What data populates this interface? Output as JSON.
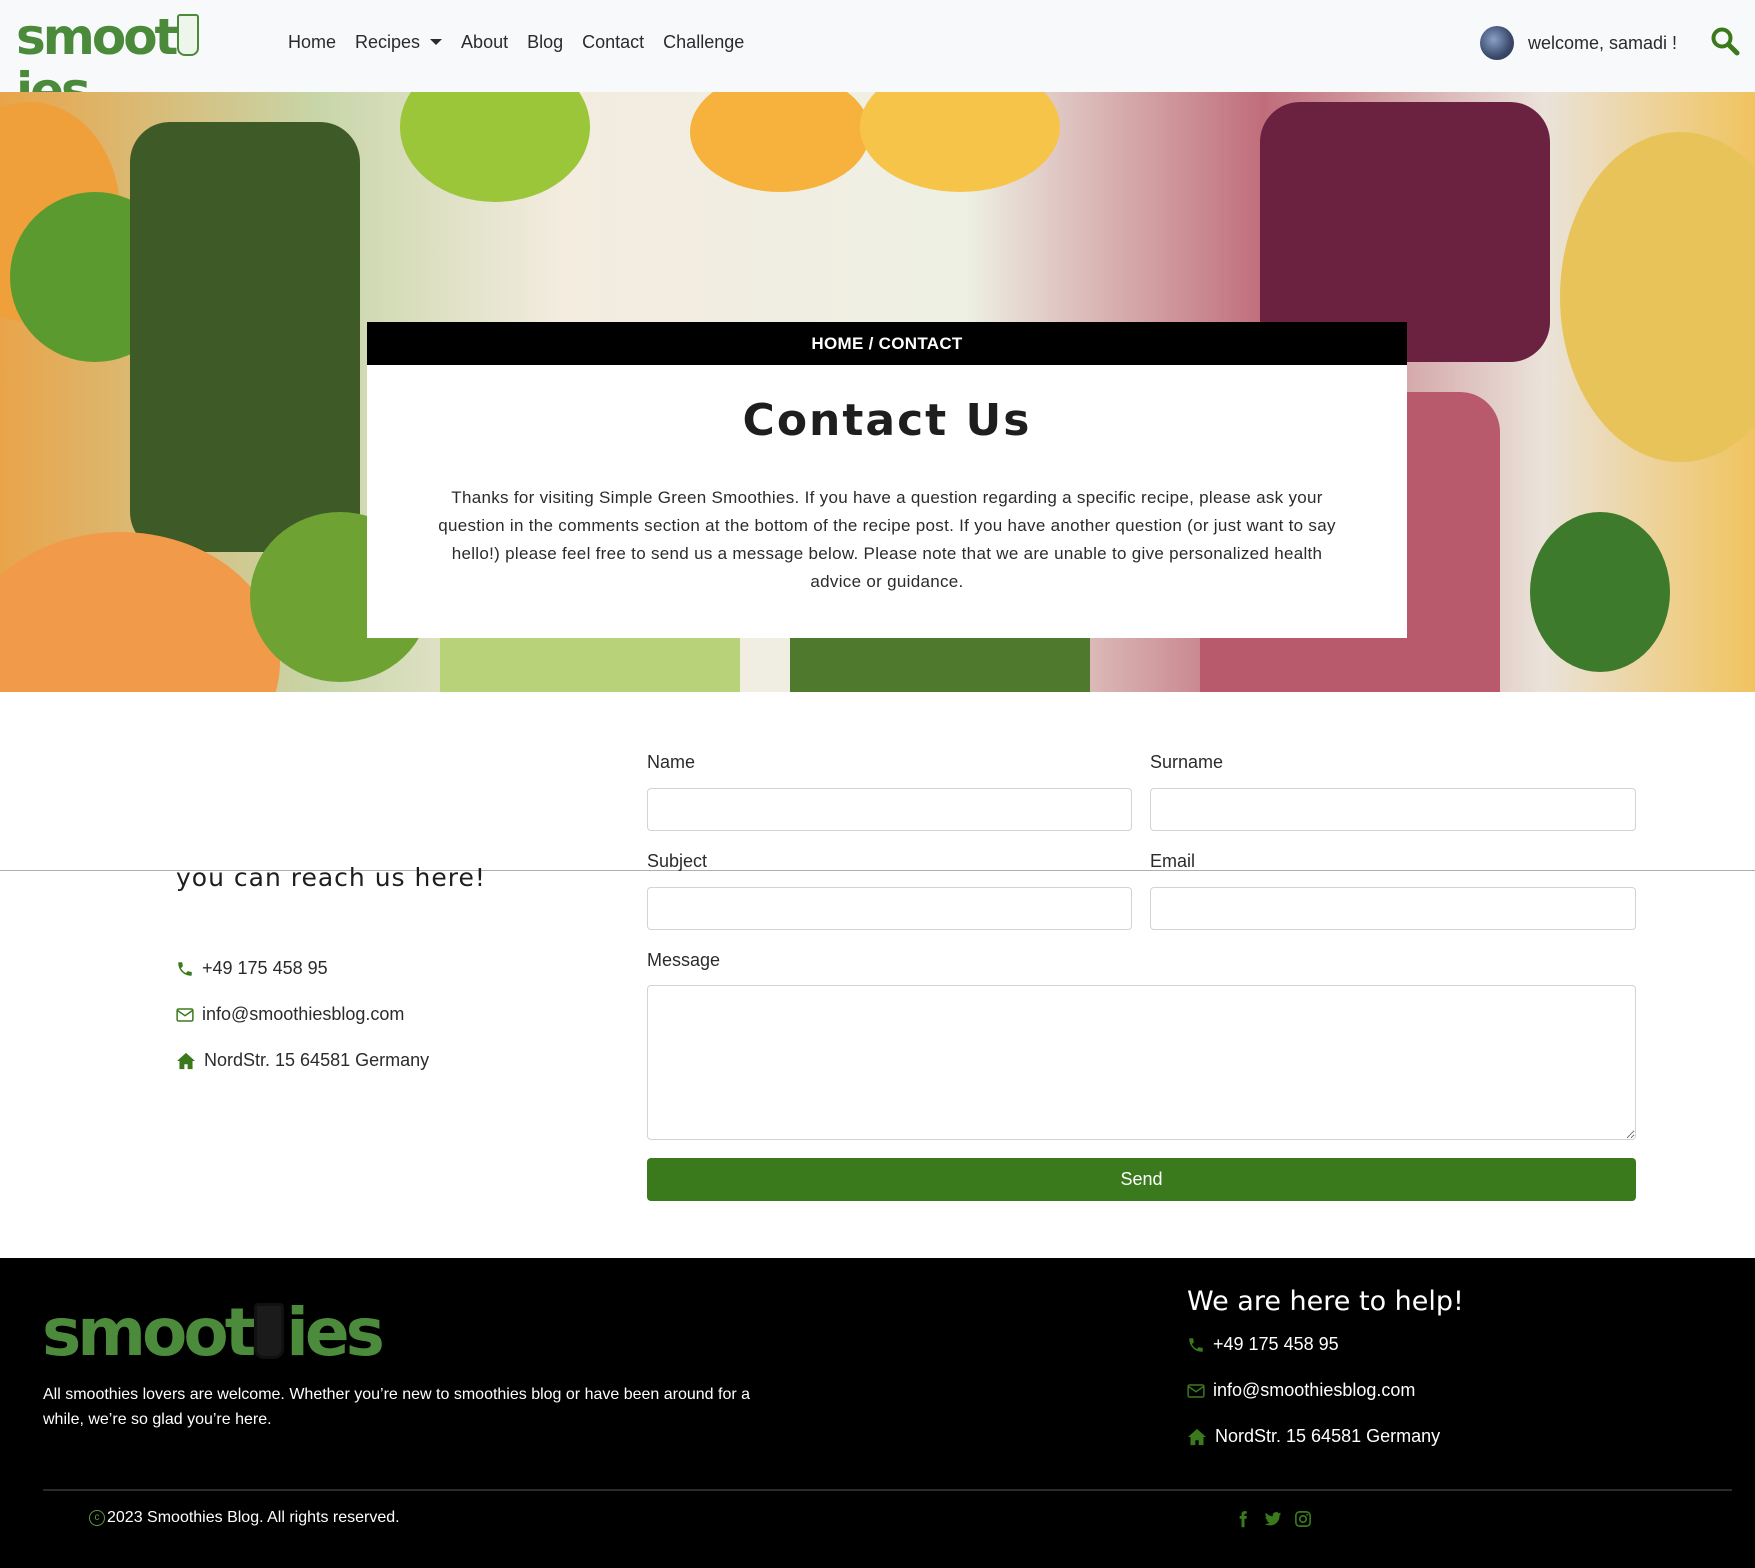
{
  "brand": {
    "logo_text_left": "smoot",
    "logo_text_right": "ies",
    "accent_color": "#3a7a1d"
  },
  "nav": {
    "links": [
      {
        "label": "Home"
      },
      {
        "label": "Recipes"
      },
      {
        "label": "About"
      },
      {
        "label": "Blog"
      },
      {
        "label": "Contact"
      },
      {
        "label": "Challenge"
      }
    ],
    "welcome": "welcome, samadi !",
    "search_icon": "search-icon"
  },
  "hero": {
    "breadcrumb": "HOME / CONTACT",
    "title": "Contact Us",
    "text": "Thanks for visiting Simple Green Smoothies. If you have a question regarding a specific recipe, please ask your question in the comments section at the bottom of the recipe post. If you have another question (or just want to say hello!) please feel free to send us a message below. Please note that we are unable to give personalized health advice or guidance."
  },
  "contact_info": {
    "heading": "you can reach us here!",
    "phone": "+49 175 458 95",
    "email": "info@smoothiesblog.com",
    "address": "NordStr. 15 64581 Germany"
  },
  "form": {
    "name_label": "Name",
    "surname_label": "Surname",
    "subject_label": "Subject",
    "email_label": "Email",
    "message_label": "Message",
    "name_value": "",
    "surname_value": "",
    "subject_value": "",
    "email_value": "",
    "message_value": "",
    "send_label": "Send"
  },
  "footer": {
    "description": "All smoothies lovers are welcome. Whether you’re new to smoothies blog or have been around for a while, we’re so glad you’re here.",
    "help_heading": "We are here to help!",
    "phone": "+49 175 458 95",
    "email": "info@smoothiesblog.com",
    "address": "NordStr. 15 64581 Germany",
    "copyright": "2023 Smoothies Blog. All rights reserved.",
    "socials": [
      "facebook-icon",
      "twitter-icon",
      "instagram-icon"
    ]
  }
}
